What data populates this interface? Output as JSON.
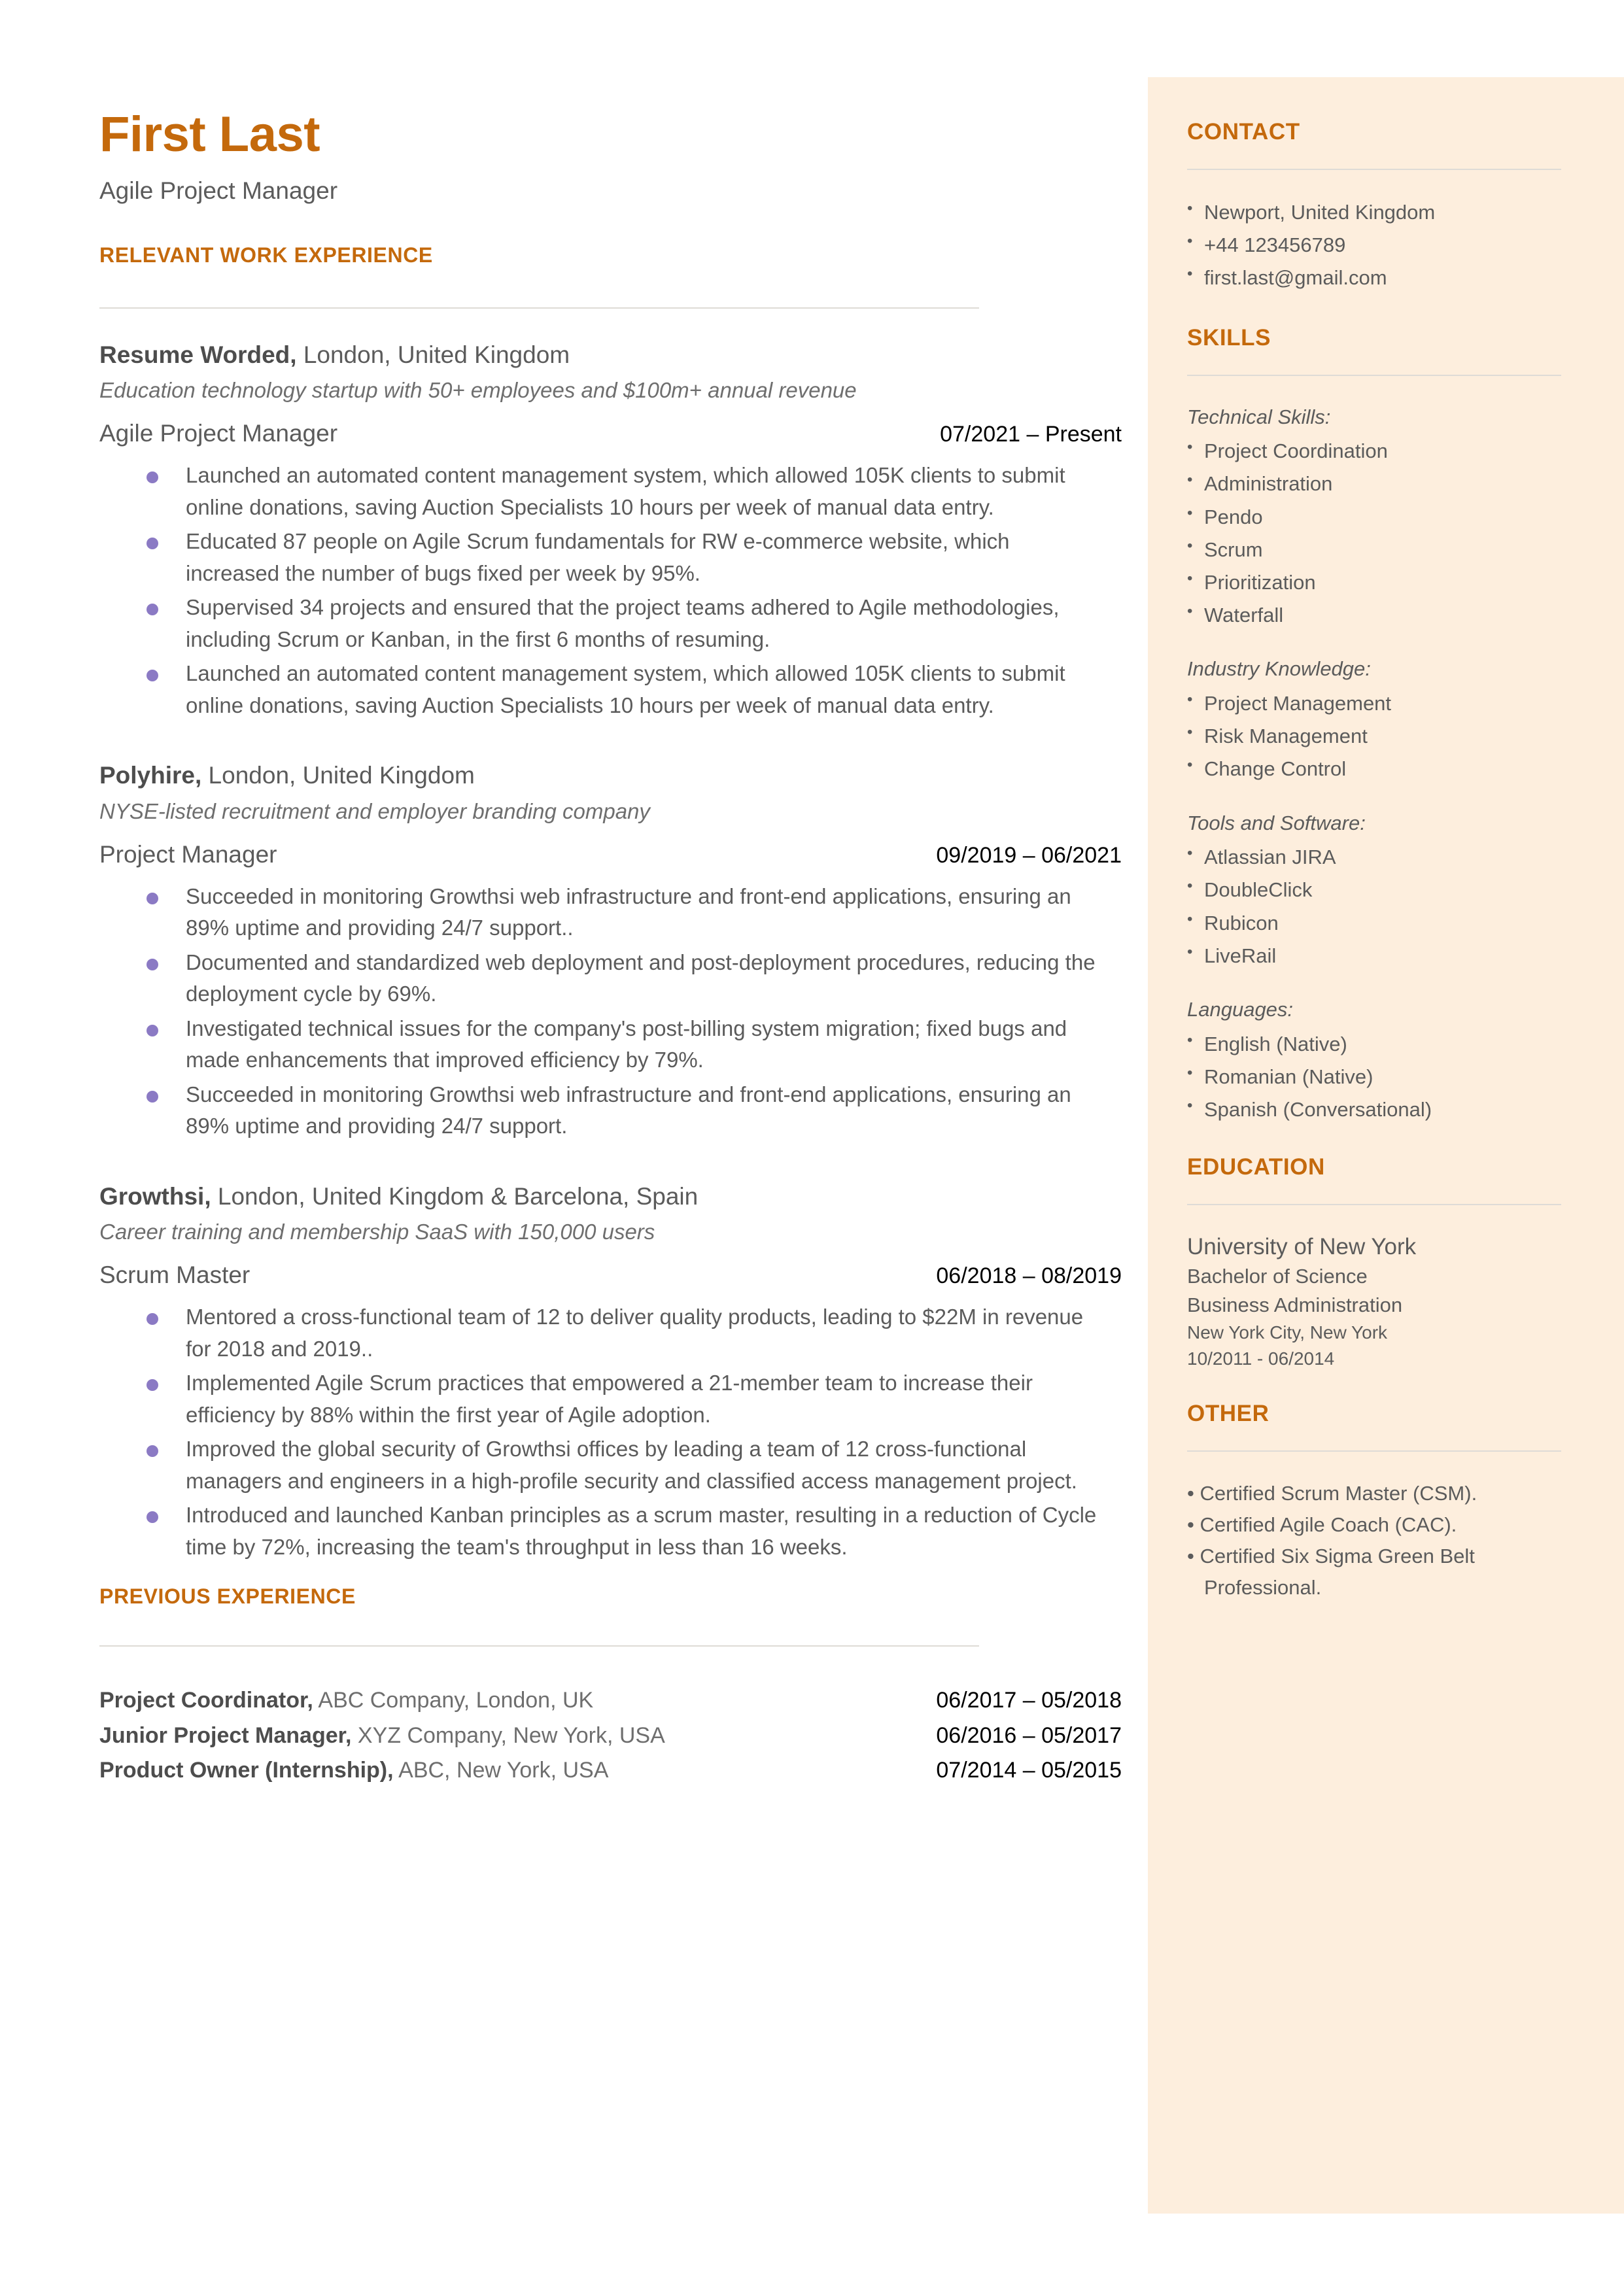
{
  "colors": {
    "accent": "#c4690c",
    "sidebar_bg": "#fdeedd",
    "body_text": "#5b5b5b",
    "bullet": "#8b7ac4",
    "rule": "#dedbd6"
  },
  "header": {
    "name": "First Last",
    "role": "Agile Project Manager"
  },
  "main": {
    "work_heading": "RELEVANT WORK EXPERIENCE",
    "jobs": [
      {
        "company": "Resume Worded,",
        "location": " London, United Kingdom",
        "tagline": "Education technology startup with 50+ employees and $100m+ annual revenue",
        "title": "Agile Project Manager",
        "dates": "07/2021 – Present",
        "bullets": [
          "Launched an automated content management system, which allowed 105K clients to submit online donations, saving Auction Specialists 10 hours per week of manual data entry.",
          "Educated 87 people on Agile Scrum fundamentals for RW e-commerce website, which increased the number of bugs fixed per week by 95%.",
          "Supervised 34 projects and ensured that the project teams adhered to Agile methodologies, including Scrum or Kanban, in the first 6 months of resuming.",
          "Launched an automated content management system, which allowed 105K clients to submit online donations, saving Auction Specialists 10 hours per week of manual data entry."
        ]
      },
      {
        "company": "Polyhire,",
        "location": " London, United Kingdom",
        "tagline": "NYSE-listed recruitment and employer branding company",
        "title": "Project Manager",
        "dates": "09/2019 – 06/2021",
        "bullets": [
          "Succeeded in monitoring Growthsi web infrastructure and front-end applications, ensuring an 89% uptime and providing 24/7 support..",
          "Documented and standardized web deployment and post-deployment procedures, reducing the deployment cycle by 69%.",
          "Investigated technical issues for the company's post-billing system migration; fixed bugs and made enhancements that improved efficiency by 79%.",
          "Succeeded in monitoring Growthsi web infrastructure and front-end applications, ensuring an 89% uptime and providing 24/7 support."
        ]
      },
      {
        "company": "Growthsi,",
        "location": " London, United Kingdom & Barcelona, Spain",
        "tagline": "Career training and membership SaaS with 150,000 users",
        "title": "Scrum Master",
        "dates": "06/2018 – 08/2019",
        "bullets": [
          "Mentored a cross-functional team of 12 to deliver quality products, leading to $22M in revenue for 2018 and 2019..",
          "Implemented Agile Scrum practices that empowered a 21-member team to increase their efficiency by 88% within the first year of Agile adoption.",
          "Improved the global security of Growthsi offices by leading a team of 12 cross-functional managers and engineers in a high-profile security and classified access management project.",
          "Introduced and launched Kanban principles as a scrum master, resulting in a reduction of Cycle time by 72%, increasing the team's throughput in less than 16 weeks."
        ]
      }
    ],
    "previous_heading": "PREVIOUS EXPERIENCE",
    "previous": [
      {
        "title": "Project Coordinator,",
        "detail": " ABC Company, London, UK",
        "dates": "06/2017 – 05/2018"
      },
      {
        "title": "Junior Project Manager,",
        "detail": " XYZ Company, New York, USA",
        "dates": "06/2016 – 05/2017"
      },
      {
        "title": "Product Owner (Internship),",
        "detail": " ABC, New York, USA",
        "dates": "07/2014 – 05/2015"
      }
    ]
  },
  "sidebar": {
    "contact": {
      "heading": "CONTACT",
      "items": [
        "Newport, United Kingdom",
        "+44 123456789",
        "first.last@gmail.com"
      ]
    },
    "skills": {
      "heading": "SKILLS",
      "groups": [
        {
          "label": "Technical Skills:",
          "items": [
            "Project Coordination",
            "Administration",
            "Pendo",
            "Scrum",
            "Prioritization",
            "Waterfall"
          ]
        },
        {
          "label": "Industry Knowledge:",
          "items": [
            "Project Management",
            "Risk Management",
            "Change Control"
          ]
        },
        {
          "label": "Tools and Software:",
          "items": [
            "Atlassian JIRA",
            "DoubleClick",
            "Rubicon",
            "LiveRail"
          ]
        },
        {
          "label": "Languages:",
          "items": [
            "English (Native)",
            "Romanian (Native)",
            "Spanish (Conversational)"
          ]
        }
      ]
    },
    "education": {
      "heading": "EDUCATION",
      "school": "University of New York",
      "degree": "Bachelor of Science",
      "field": "Business Administration",
      "location": "New York City, New York",
      "dates": "10/2011 - 06/2014"
    },
    "other": {
      "heading": "OTHER",
      "items": [
        "Certified Scrum Master (CSM).",
        "Certified Agile Coach (CAC).",
        "Certified Six Sigma Green Belt Professional."
      ]
    }
  }
}
